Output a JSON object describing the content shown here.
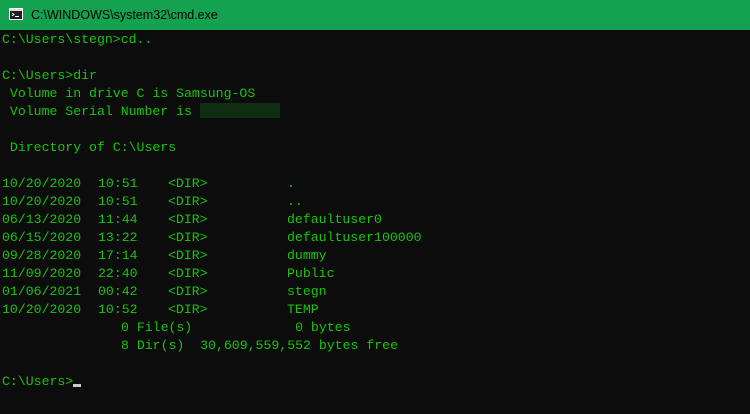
{
  "window": {
    "title": "C:\\WINDOWS\\system32\\cmd.exe",
    "icon": "cmd-icon",
    "titlebar_color": "#14a150",
    "text_color": "#16c60c"
  },
  "console": {
    "cmd1": "C:\\Users\\stegn>cd..",
    "cmd2": "C:\\Users>dir",
    "volume_line": " Volume in drive C is Samsung-OS",
    "serial_label": " Volume Serial Number is ",
    "directory_line": " Directory of C:\\Users",
    "entries": [
      {
        "date": "10/20/2020",
        "time": "10:51",
        "type": "<DIR>",
        "name": "."
      },
      {
        "date": "10/20/2020",
        "time": "10:51",
        "type": "<DIR>",
        "name": ".."
      },
      {
        "date": "06/13/2020",
        "time": "11:44",
        "type": "<DIR>",
        "name": "defaultuser0"
      },
      {
        "date": "06/15/2020",
        "time": "13:22",
        "type": "<DIR>",
        "name": "defaultuser100000"
      },
      {
        "date": "09/28/2020",
        "time": "17:14",
        "type": "<DIR>",
        "name": "dummy"
      },
      {
        "date": "11/09/2020",
        "time": "22:40",
        "type": "<DIR>",
        "name": "Public"
      },
      {
        "date": "01/06/2021",
        "time": "00:42",
        "type": "<DIR>",
        "name": "stegn"
      },
      {
        "date": "10/20/2020",
        "time": "10:52",
        "type": "<DIR>",
        "name": "TEMP"
      }
    ],
    "files_summary": "0 File(s)             0 bytes",
    "dirs_summary": "8 Dir(s)  30,609,559,552 bytes free",
    "prompt": "C:\\Users>"
  }
}
